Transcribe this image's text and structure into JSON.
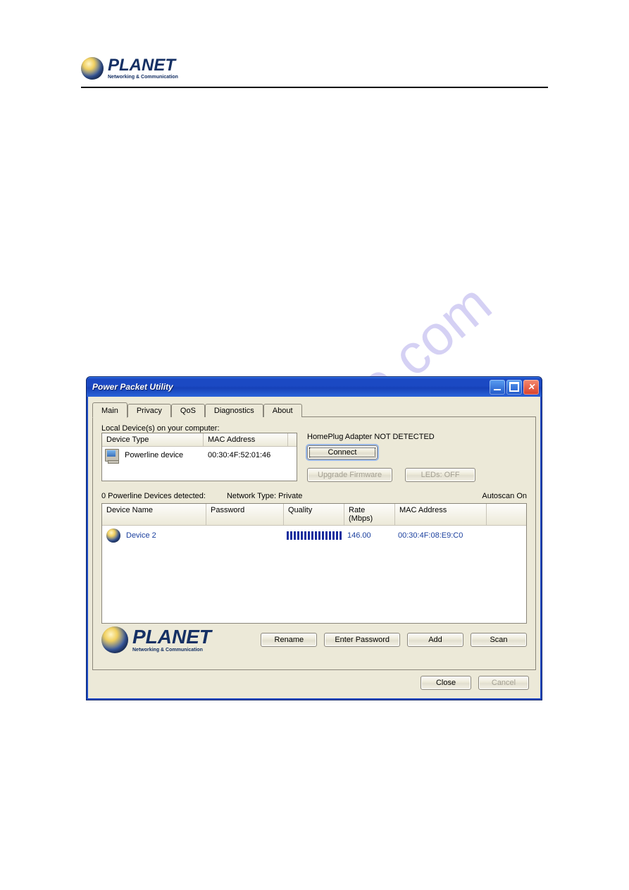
{
  "page_header": {
    "brand": "PLANET",
    "tagline": "Networking & Communication"
  },
  "watermark": "manualshive.com",
  "window": {
    "title": "Power Packet Utility",
    "tabs": [
      "Main",
      "Privacy",
      "QoS",
      "Diagnostics",
      "About"
    ],
    "active_tab": 0,
    "local_section": {
      "heading": "Local Device(s) on your computer:",
      "columns": {
        "type": "Device Type",
        "mac": "MAC Address"
      },
      "rows": [
        {
          "type": "Powerline device",
          "mac": "00:30:4F:52:01:46"
        }
      ]
    },
    "status_text": "HomePlug Adapter NOT DETECTED",
    "buttons": {
      "connect": "Connect",
      "upgrade": "Upgrade Firmware",
      "leds": "LEDs:   OFF"
    },
    "detect": {
      "count_label": "0 Powerline Devices detected:",
      "network_type_label": "Network Type: Private",
      "autoscan_label": "Autoscan On"
    },
    "remote_table": {
      "columns": {
        "name": "Device Name",
        "password": "Password",
        "quality": "Quality",
        "rate": "Rate (Mbps)",
        "mac": "MAC Address"
      },
      "rows": [
        {
          "name": "Device 2",
          "password": "",
          "rate": "146.00",
          "mac": "00:30:4F:08:E9:C0"
        }
      ]
    },
    "footer_brand": {
      "brand": "PLANET",
      "tagline": "Networking & Communication"
    },
    "action_buttons": {
      "rename": "Rename",
      "enter_password": "Enter Password",
      "add": "Add",
      "scan": "Scan"
    },
    "bottom_buttons": {
      "close": "Close",
      "cancel": "Cancel"
    }
  }
}
